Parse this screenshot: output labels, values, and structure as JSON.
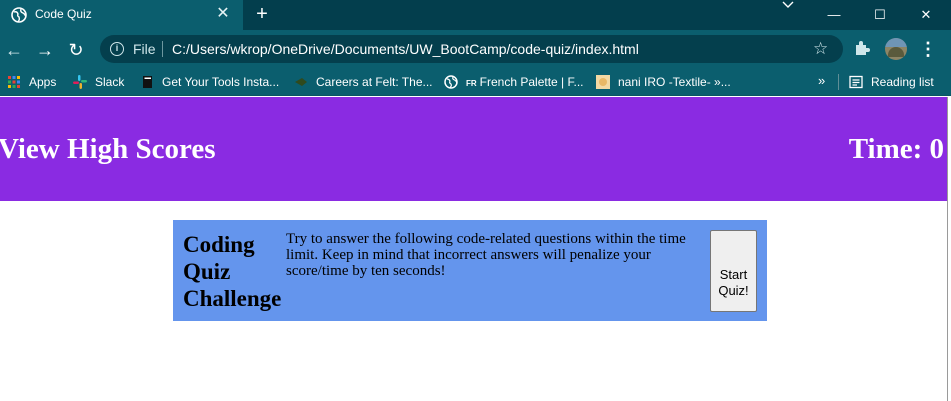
{
  "browser": {
    "tab_title": "Code Quiz",
    "file_label": "File",
    "url": "C:/Users/wkrop/OneDrive/Documents/UW_BootCamp/code-quiz/index.html",
    "bookmarks": [
      {
        "label": "Apps",
        "icon": "apps-grid-icon"
      },
      {
        "label": "Slack",
        "icon": "slack-icon"
      },
      {
        "label": "Get Your Tools Insta...",
        "icon": "book-icon"
      },
      {
        "label": "Careers at Felt: The...",
        "icon": "felt-icon"
      },
      {
        "label": "French Palette | F...",
        "icon": "globe-icon",
        "prefix": "FR"
      },
      {
        "label": "nani IRO -Textile- »...",
        "icon": "nani-iro-icon"
      }
    ],
    "more_bookmarks": "»",
    "reading_list": "Reading list"
  },
  "header": {
    "view_high_scores": "View High Scores",
    "time_label": "Time:",
    "time_value": "0"
  },
  "quiz": {
    "title": "Coding Quiz Challenge",
    "instructions": "Try to answer the following code-related questions within the time limit. Keep in mind that incorrect answers will penalize your score/time by ten seconds!",
    "start_button": "Start Quiz!"
  },
  "colors": {
    "header_bg": "#8a2be2",
    "card_bg": "#6495ed",
    "chrome_bg": "#0b5e6e"
  }
}
